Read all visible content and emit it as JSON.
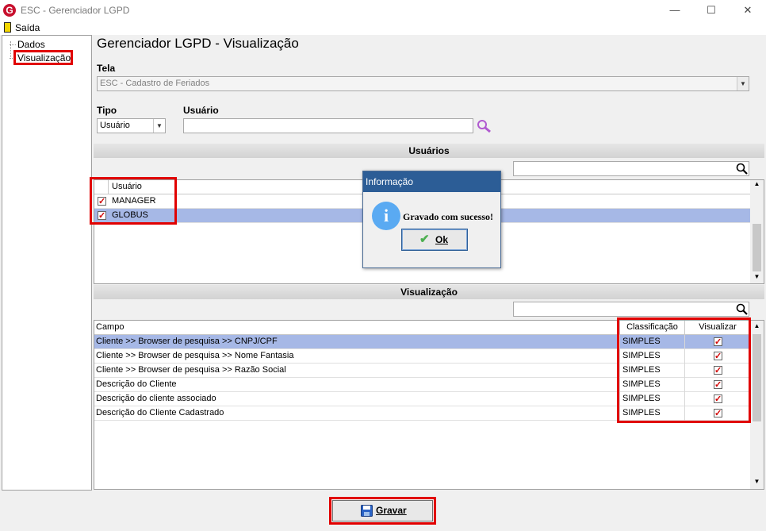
{
  "window": {
    "app_icon": "G",
    "title": "ESC - Gerenciador LGPD",
    "minimize": "—",
    "maximize": "☐",
    "close": "✕"
  },
  "menu": {
    "exit_label": "Saída"
  },
  "tree": {
    "items": [
      {
        "label": "Dados"
      },
      {
        "label": "Visualização"
      }
    ]
  },
  "page": {
    "title": "Gerenciador LGPD - Visualização"
  },
  "tela": {
    "label": "Tela",
    "value": "ESC - Cadastro de Feriados"
  },
  "tipo": {
    "label": "Tipo",
    "value": "Usuário"
  },
  "usuario_field": {
    "label": "Usuário",
    "value": ""
  },
  "usuarios_section": {
    "title": "Usuários",
    "column": "Usuário",
    "rows": [
      {
        "name": "MANAGER",
        "checked": true
      },
      {
        "name": "GLOBUS",
        "checked": true,
        "selected": true
      }
    ]
  },
  "visualizacao_section": {
    "title": "Visualização",
    "columns": {
      "campo": "Campo",
      "classificacao": "Classificação",
      "visualizar": "Visualizar"
    },
    "rows": [
      {
        "campo": "Cliente >> Browser de pesquisa >> CNPJ/CPF",
        "classificacao": "SIMPLES",
        "visualizar": true
      },
      {
        "campo": "Cliente >> Browser de pesquisa >> Nome Fantasia",
        "classificacao": "SIMPLES",
        "visualizar": true
      },
      {
        "campo": "Cliente >> Browser de pesquisa >> Razão Social",
        "classificacao": "SIMPLES",
        "visualizar": true
      },
      {
        "campo": "Descrição do Cliente",
        "classificacao": "SIMPLES",
        "visualizar": true
      },
      {
        "campo": "Descrição do cliente associado",
        "classificacao": "SIMPLES",
        "visualizar": true
      },
      {
        "campo": "Descrição do Cliente Cadastrado",
        "classificacao": "SIMPLES",
        "visualizar": true
      }
    ]
  },
  "dialog": {
    "title": "Informação",
    "icon": "i",
    "message": "Gravado com sucesso!",
    "ok_label": "Ok"
  },
  "footer": {
    "save_label": "Gravar"
  },
  "colors": {
    "selection": "#a6b8e6",
    "dialog_title": "#2c5d96",
    "highlight": "#e10000",
    "check": "#d00000"
  }
}
